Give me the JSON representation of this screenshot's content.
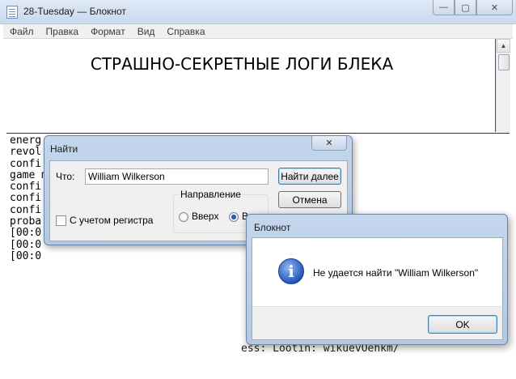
{
  "window": {
    "title": "28-Tuesday — Блокнот",
    "controls": {
      "minimize": "▭",
      "maximize": "□",
      "close": "✕"
    }
  },
  "menu": [
    "Файл",
    "Правка",
    "Формат",
    "Вид",
    "Справка"
  ],
  "editor": {
    "heading": "СТРАШНО-СЕКРЕТНЫЕ ЛОГИ БЛЕКА"
  },
  "log": {
    "lines": [
      "energ",
      "revol",
      "confi",
      "game m",
      "confi",
      "confi",
      "confi",
      "proba",
      "[00:0",
      "[00:0",
      "[00:0"
    ],
    "tail": "ess: Lootin: wikuevOehkm/"
  },
  "find_dialog": {
    "title": "Найти",
    "what_label": "Что:",
    "query": "William Wilkerson",
    "find_next": "Найти далее",
    "cancel": "Отмена",
    "direction_label": "Направление",
    "up": "Вверх",
    "down": "Вниз",
    "match_case": "С учетом регистра"
  },
  "message_box": {
    "title": "Блокнот",
    "text": "Не удается найти \"William Wilkerson\"",
    "ok": "OK",
    "icon": "info-icon"
  }
}
